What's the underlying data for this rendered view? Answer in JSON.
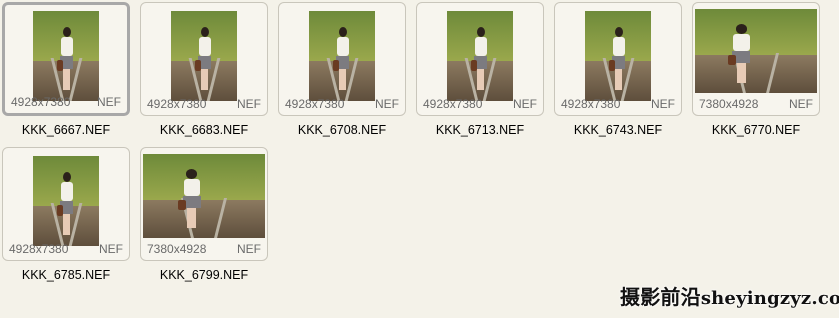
{
  "files": [
    {
      "name": "KKK_6667.NEF",
      "dims": "4928x7380",
      "type": "NEF",
      "orientation": "portrait",
      "selected": true
    },
    {
      "name": "KKK_6683.NEF",
      "dims": "4928x7380",
      "type": "NEF",
      "orientation": "portrait",
      "selected": false
    },
    {
      "name": "KKK_6708.NEF",
      "dims": "4928x7380",
      "type": "NEF",
      "orientation": "portrait",
      "selected": false
    },
    {
      "name": "KKK_6713.NEF",
      "dims": "4928x7380",
      "type": "NEF",
      "orientation": "portrait",
      "selected": false
    },
    {
      "name": "KKK_6743.NEF",
      "dims": "4928x7380",
      "type": "NEF",
      "orientation": "portrait",
      "selected": false
    },
    {
      "name": "KKK_6770.NEF",
      "dims": "7380x4928",
      "type": "NEF",
      "orientation": "landscape",
      "selected": false
    },
    {
      "name": "KKK_6785.NEF",
      "dims": "4928x7380",
      "type": "NEF",
      "orientation": "portrait",
      "selected": false
    },
    {
      "name": "KKK_6799.NEF",
      "dims": "7380x4928",
      "type": "NEF",
      "orientation": "landscape",
      "selected": false
    }
  ],
  "watermark": {
    "cjk": "摄影前沿",
    "latin": "sheyingzyz.com"
  }
}
